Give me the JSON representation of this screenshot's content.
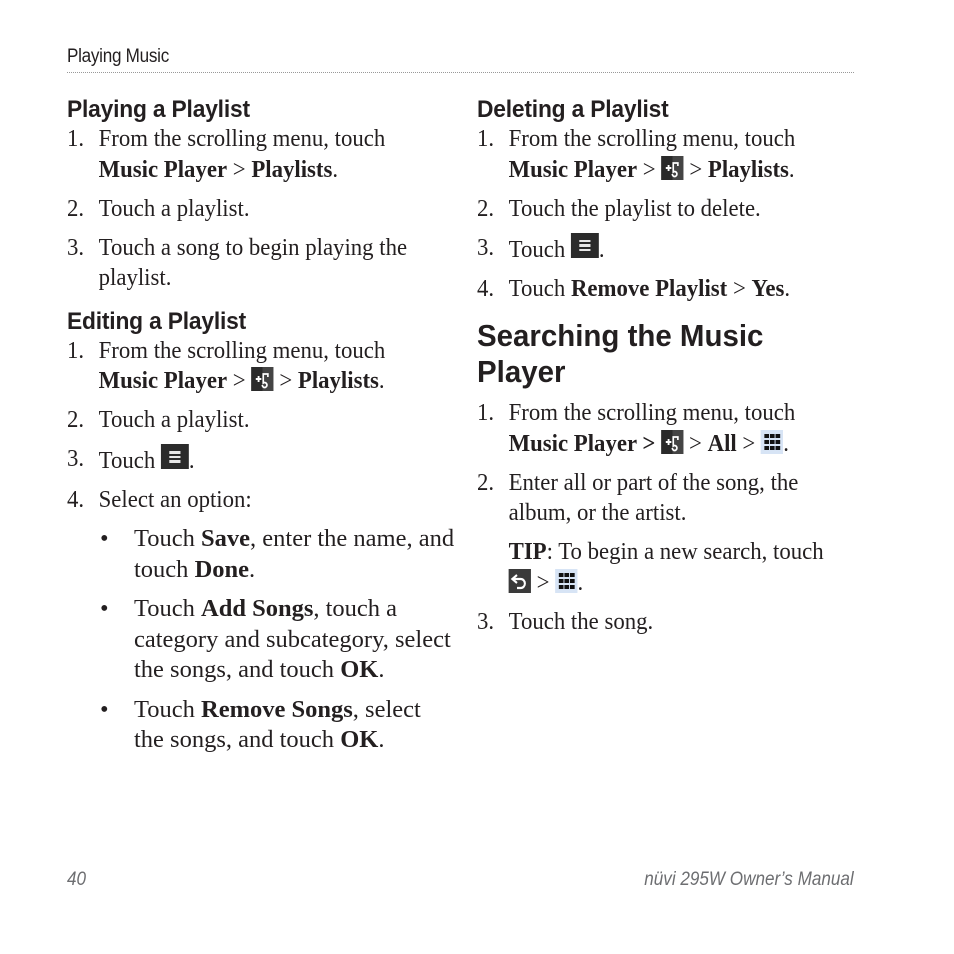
{
  "header": {
    "section": "Playing Music"
  },
  "left": {
    "playing": {
      "heading": "Playing a Playlist",
      "steps": [
        {
          "num": "1.",
          "line1": "From the scrolling menu, touch",
          "b1": "Music Player",
          "sep": " > ",
          "b2": "Playlists",
          "end": "."
        },
        {
          "num": "2.",
          "text": "Touch a playlist."
        },
        {
          "num": "3.",
          "line1": "Touch a song to begin playing the",
          "line2": "playlist."
        }
      ]
    },
    "editing": {
      "heading": "Editing a Playlist",
      "steps": [
        {
          "num": "1.",
          "line1": "From the scrolling menu, touch",
          "b1": "Music Player",
          "sep1": " > ",
          "sep2": " > ",
          "b2": "Playlists",
          "end": "."
        },
        {
          "num": "2.",
          "text": "Touch a playlist."
        },
        {
          "num": "3.",
          "text": "Touch ",
          "end": "."
        },
        {
          "num": "4.",
          "text": "Select an option:"
        }
      ],
      "bullets": [
        {
          "dot": "•",
          "a": "Touch ",
          "b": "Save",
          "c": ", enter the name, and",
          "d": "touch ",
          "e": "Done",
          "f": "."
        },
        {
          "dot": "•",
          "a": "Touch ",
          "b": "Add Songs",
          "c": ", touch a",
          "l2": "category and subcategory, select",
          "d": "the songs, and touch ",
          "e": "OK",
          "f": "."
        },
        {
          "dot": "•",
          "a": "Touch ",
          "b": "Remove Songs",
          "c": ", select",
          "d": "the songs, and touch ",
          "e": "OK",
          "f": "."
        }
      ]
    }
  },
  "right": {
    "deleting": {
      "heading": "Deleting a Playlist",
      "steps": [
        {
          "num": "1.",
          "line1": "From the scrolling menu, touch",
          "b1": "Music Player",
          "sep1": " > ",
          "sep2": " > ",
          "b2": "Playlists",
          "end": "."
        },
        {
          "num": "2.",
          "text": "Touch the playlist to delete."
        },
        {
          "num": "3.",
          "text": "Touch ",
          "end": "."
        },
        {
          "num": "4.",
          "text": "Touch ",
          "b1": "Remove Playlist",
          "sep": " > ",
          "b2": "Yes",
          "end": "."
        }
      ]
    },
    "searching": {
      "heading": "Searching the Music Player",
      "heading_l1": "Searching the Music",
      "heading_l2": "Player",
      "steps": [
        {
          "num": "1.",
          "line1": "From the scrolling menu, touch",
          "b1": "Music Player >",
          "sep1": " ",
          "sep2": " > ",
          "b2": "All",
          "sep3": " > ",
          "end": "."
        },
        {
          "num": "2.",
          "line1": "Enter all or part of the song, the",
          "line2": "album, or the artist."
        },
        {
          "num": "3.",
          "text": "Touch the song."
        }
      ],
      "tip": {
        "label": "TIP",
        "text": ": To begin a new search, touch",
        "sep": " > ",
        "end": "."
      }
    }
  },
  "footer": {
    "page": "40",
    "title": "nüvi 295W Owner’s Manual"
  },
  "icons": {
    "music": "music-options-icon",
    "menu": "menu-icon",
    "grid": "keyboard-grid-icon",
    "back": "back-icon"
  }
}
